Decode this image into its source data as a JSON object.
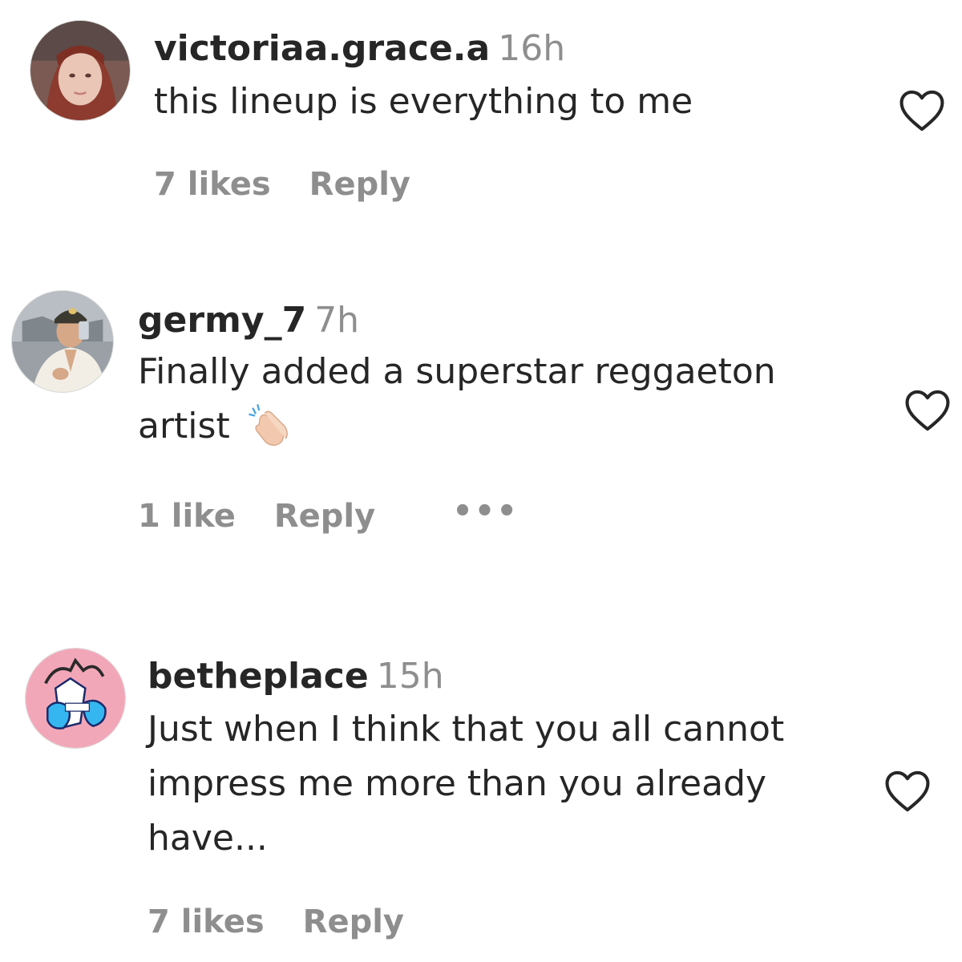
{
  "comments": [
    {
      "username": "victoriaa.grace.a",
      "time": "16h",
      "text_lines": [
        "this lineup is everything to me"
      ],
      "likes": "7 likes",
      "reply": "Reply"
    },
    {
      "username": "germy_7",
      "time": "7h",
      "text_lines": [
        "Finally added a superstar reggaeton",
        "artist"
      ],
      "emoji": "clapping-hands-icon",
      "likes": "1 like",
      "reply": "Reply",
      "more": "•••"
    },
    {
      "username": "betheplace",
      "time": "15h",
      "text_lines": [
        "Just when I think that you all cannot",
        "impress me more than you already",
        "have..."
      ],
      "likes": "7 likes",
      "reply": "Reply"
    }
  ],
  "colors": {
    "text": "#262626",
    "muted": "#8e8e8e",
    "background": "#ffffff"
  }
}
